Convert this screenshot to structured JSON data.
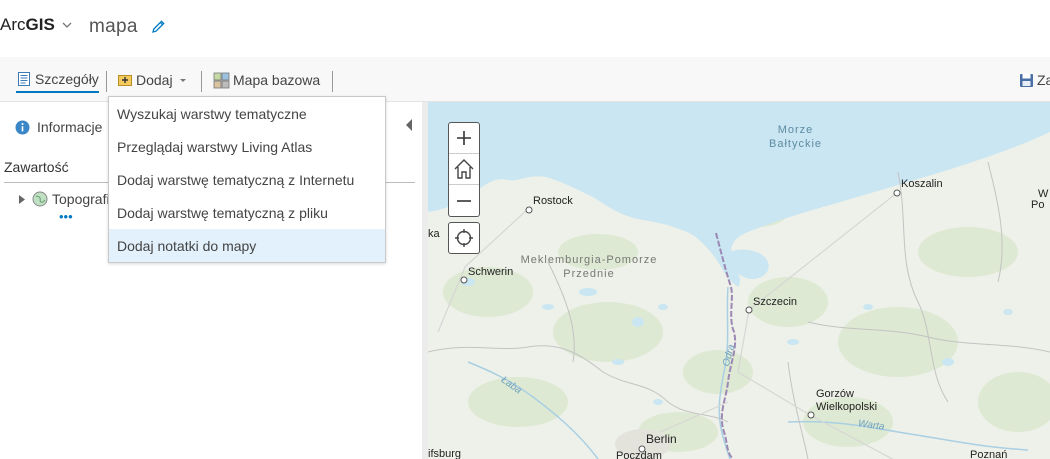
{
  "header": {
    "brand_prefix": "Arc",
    "brand_bold": "GIS",
    "map_title": "mapa"
  },
  "toolbar": {
    "details": "Szczegóły",
    "add": "Dodaj",
    "basemap": "Mapa bazowa",
    "save_partial": "Za"
  },
  "add_menu": {
    "items": [
      "Wyszukaj warstwy tematyczne",
      "Przeglądaj warstwy Living Atlas",
      "Dodaj warstwę tematyczną z Internetu",
      "Dodaj warstwę tematyczną z pliku",
      "Dodaj notatki do mapy"
    ]
  },
  "left_panel": {
    "info_tab": "Informacje",
    "contents_label": "Zawartość",
    "layer_name": "Topografi",
    "layer_dots": "•••"
  },
  "map": {
    "sea_line1": "Morze",
    "sea_line2": "Bałtyckie",
    "region_line1": "Meklemburgia-Pomorze",
    "region_line2": "Przednie",
    "cities": {
      "rostock": "Rostock",
      "schwerin": "Schwerin",
      "szczecin": "Szczecin",
      "koszalin": "Koszalin",
      "gorzow1": "Gorzów",
      "gorzow2": "Wielkopolski",
      "berlin": "Berlin",
      "poczdam": "Poczdam",
      "poznan": "Poznań",
      "edge_left": "ka",
      "edge_left2": "ifsburg",
      "edge_right1": "W",
      "edge_right2": "Po"
    },
    "rivers": {
      "odra": "Odra",
      "laba": "Łaba",
      "warta": "Warta"
    },
    "colors": {
      "water": "#c9e6f2",
      "land": "#eef1e9",
      "green": "#dde9d2",
      "border": "#9c88b4"
    }
  }
}
